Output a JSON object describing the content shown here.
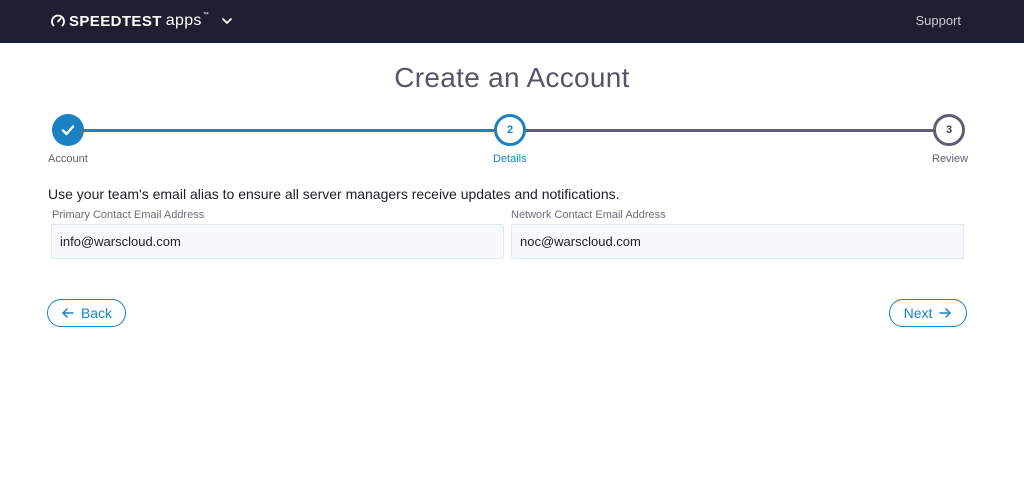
{
  "header": {
    "brand": "SPEEDTEST",
    "apps": "apps",
    "tm": "™",
    "support_label": "Support"
  },
  "page": {
    "title": "Create an Account"
  },
  "stepper": {
    "steps": [
      {
        "label": "Account",
        "number": "1",
        "state": "complete"
      },
      {
        "label": "Details",
        "number": "2",
        "state": "current"
      },
      {
        "label": "Review",
        "number": "3",
        "state": "pending"
      }
    ]
  },
  "form": {
    "instruction": "Use your team's email alias to ensure all server managers receive updates and notifications.",
    "primary_email": {
      "label": "Primary Contact Email Address",
      "value": "info@warscloud.com"
    },
    "network_email": {
      "label": "Network Contact Email Address",
      "value": "noc@warscloud.com"
    }
  },
  "actions": {
    "back_label": "Back",
    "next_label": "Next"
  },
  "colors": {
    "header_bg": "#1e1f33",
    "accent": "#1a82c4",
    "pending": "#5e5f72"
  },
  "icons": {
    "logo": "speedometer-icon",
    "menu": "chevron-down-icon",
    "complete": "check-icon",
    "back": "arrow-left-icon",
    "next": "arrow-right-icon"
  }
}
